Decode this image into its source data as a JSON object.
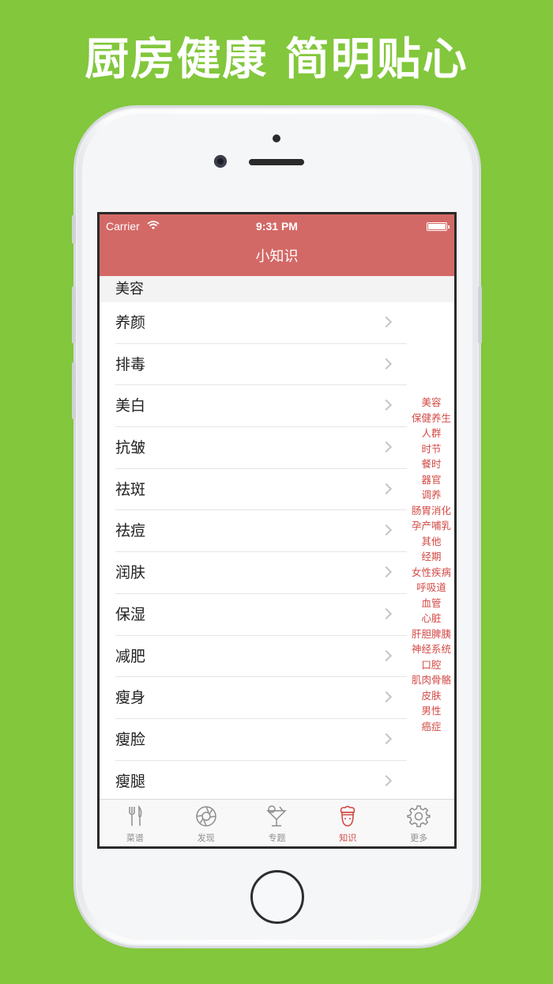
{
  "headline": "厨房健康 简明贴心",
  "status": {
    "carrier": "Carrier",
    "time": "9:31 PM"
  },
  "navbar": {
    "title": "小知识"
  },
  "section": {
    "title": "美容"
  },
  "rows": [
    "养颜",
    "排毒",
    "美白",
    "抗皱",
    "祛斑",
    "祛痘",
    "润肤",
    "保湿",
    "减肥",
    "瘦身",
    "瘦脸",
    "瘦腿"
  ],
  "index": [
    "美容",
    "保健养生",
    "人群",
    "时节",
    "餐时",
    "器官",
    "调养",
    "肠胃消化",
    "孕产哺乳",
    "其他",
    "经期",
    "女性疾病",
    "呼吸道",
    "血管",
    "心脏",
    "肝胆脾胰",
    "神经系统",
    "口腔",
    "肌肉骨骼",
    "皮肤",
    "男性",
    "癌症"
  ],
  "tabs": [
    {
      "label": "菜谱",
      "icon": "fork-knife-icon",
      "active": false
    },
    {
      "label": "发现",
      "icon": "aperture-icon",
      "active": false
    },
    {
      "label": "专题",
      "icon": "cocktail-icon",
      "active": false
    },
    {
      "label": "知识",
      "icon": "chef-icon",
      "active": true
    },
    {
      "label": "更多",
      "icon": "gear-icon",
      "active": false
    }
  ],
  "colors": {
    "background": "#82c73c",
    "accent": "#d36966",
    "index_text": "#d34a45"
  }
}
